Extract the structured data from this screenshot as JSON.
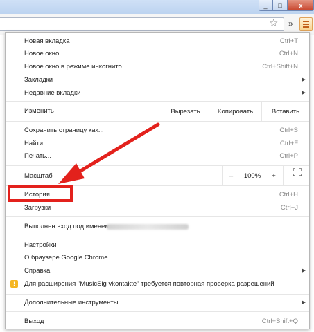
{
  "window": {
    "min_glyph": "_",
    "max_glyph": "□",
    "close_glyph": "x"
  },
  "toolbar": {
    "star_glyph": "☆",
    "extensions_glyph": "»"
  },
  "menu": {
    "group1": [
      {
        "label": "Новая вкладка",
        "shortcut": "Ctrl+T"
      },
      {
        "label": "Новое окно",
        "shortcut": "Ctrl+N"
      },
      {
        "label": "Новое окно в режиме инкогнито",
        "shortcut": "Ctrl+Shift+N"
      },
      {
        "label": "Закладки",
        "shortcut": ""
      },
      {
        "label": "Недавние вкладки",
        "shortcut": ""
      }
    ],
    "edit": {
      "label": "Изменить",
      "cut": "Вырезать",
      "copy": "Копировать",
      "paste": "Вставить"
    },
    "group2": [
      {
        "label": "Сохранить страницу как...",
        "shortcut": "Ctrl+S"
      },
      {
        "label": "Найти...",
        "shortcut": "Ctrl+F"
      },
      {
        "label": "Печать...",
        "shortcut": "Ctrl+P"
      }
    ],
    "zoom": {
      "label": "Масштаб",
      "minus": "–",
      "value": "100%",
      "plus": "+"
    },
    "group3": [
      {
        "label": "История",
        "shortcut": "Ctrl+H"
      },
      {
        "label": "Загрузки",
        "shortcut": "Ctrl+J"
      }
    ],
    "signed_in": {
      "label": "Выполнен вход под именем"
    },
    "group4": [
      {
        "label": "Настройки"
      },
      {
        "label": "О браузере Google Chrome"
      },
      {
        "label": "Справка"
      }
    ],
    "warning": {
      "icon_glyph": "!",
      "label": "Для расширения \"MusicSig vkontakte\" требуется повторная проверка разрешений"
    },
    "tools": {
      "label": "Дополнительные инструменты"
    },
    "exit": {
      "label": "Выход",
      "shortcut": "Ctrl+Shift+Q"
    }
  },
  "colors": {
    "highlight": "#e3211c",
    "menu_button": "#f8d38f",
    "warning": "#f5b622"
  }
}
